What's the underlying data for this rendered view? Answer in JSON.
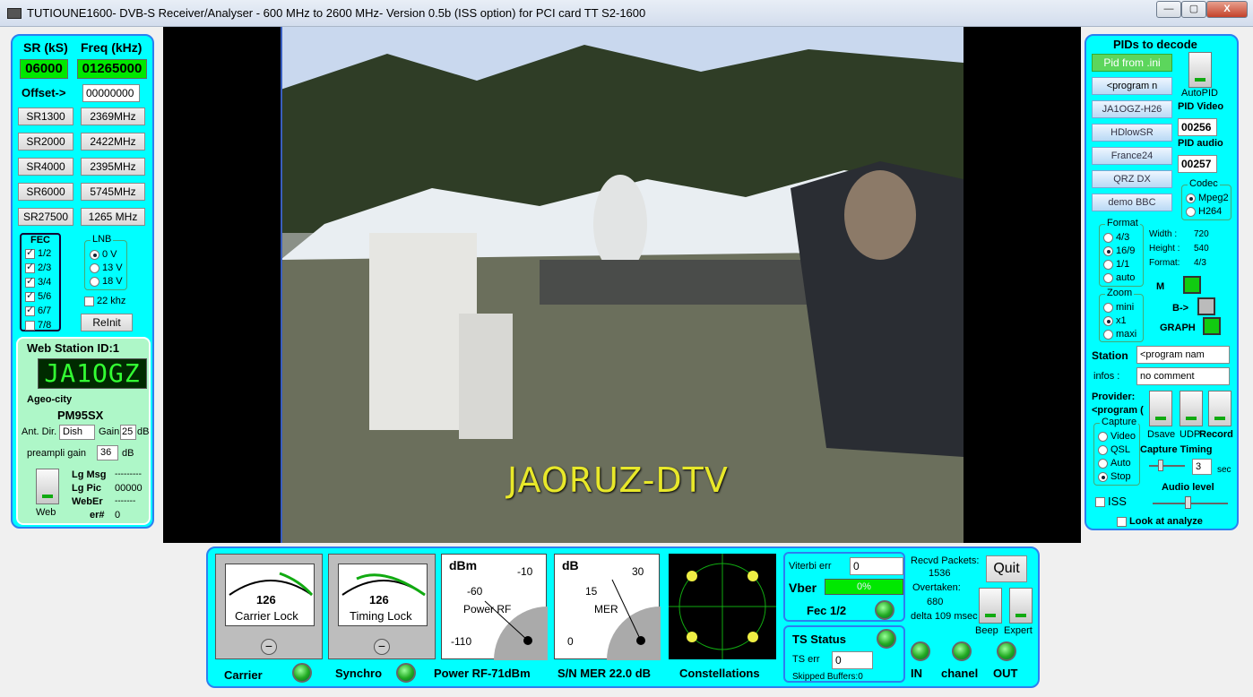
{
  "window": {
    "title": "TUTIOUNE1600- DVB-S Receiver/Analyser - 600 MHz to 2600 MHz- Version 0.5b (ISS option) for PCI card TT S2-1600",
    "min": "—",
    "max": "▢",
    "close": "X"
  },
  "left": {
    "sr_label": "SR (kS)",
    "freq_label": "Freq (kHz)",
    "sr_value": "06000",
    "freq_value": "01265000",
    "offset_label": "Offset->",
    "offset_value": "00000000",
    "sr_buttons": [
      "SR1300",
      "SR2000",
      "SR4000",
      "SR6000",
      "SR27500"
    ],
    "freq_buttons": [
      "2369MHz",
      "2422MHz",
      "2395MHz",
      "5745MHz",
      "1265 MHz"
    ],
    "fec_title": "FEC",
    "fec": [
      "1/2",
      "2/3",
      "3/4",
      "5/6",
      "6/7",
      "7/8"
    ],
    "lnb_title": "LNB",
    "lnb": [
      "0 V",
      "13 V",
      "18 V"
    ],
    "khz22": "22 khz",
    "reinit": "ReInit",
    "web_title": "Web Station ID:1",
    "callsign": "JA1OGZ",
    "city": "Ageo-city",
    "locator": "PM95SX",
    "ant_label": "Ant. Dir.",
    "ant_value": "Dish",
    "gain_label": "Gain",
    "gain_value": "25",
    "gain_unit": "dB",
    "preamp_label": "preampli gain",
    "preamp_value": "36",
    "preamp_unit": "dB",
    "web_label": "Web",
    "lgmsg_label": "Lg Msg",
    "lgmsg_value": "---------",
    "lgpic_label": "Lg Pic",
    "lgpic_value": "00000",
    "weber_label": "WebEr",
    "weber_value": "-------",
    "err_label": "er#",
    "err_value": "0"
  },
  "video": {
    "overlay": "JAORUZ-DTV"
  },
  "right": {
    "title": "PIDs to decode",
    "pid_ini": "Pid from .ini",
    "program_btn": "<program n",
    "preset_buttons": [
      "JA1OGZ-H26",
      "HDlowSR",
      "France24",
      "QRZ DX",
      "demo BBC"
    ],
    "autopid": "AutoPID",
    "pid_video_label": "PID Video",
    "pid_video": "00256",
    "pid_audio_label": "PID audio",
    "pid_audio": "00257",
    "codec_title": "Codec",
    "codec": [
      "Mpeg2",
      "H264"
    ],
    "format_title": "Format",
    "format": [
      "4/3",
      "16/9",
      "1/1",
      "auto"
    ],
    "width_label": "Width :",
    "width_value": "720",
    "height_label": "Height :",
    "height_value": "540",
    "fmt_label": "Format:",
    "fmt_value": "4/3",
    "zoom_title": "Zoom",
    "zoom": [
      "mini",
      "x1",
      "maxi"
    ],
    "m_label": "M",
    "b_label": "B->",
    "graph_label": "GRAPH",
    "station_label": "Station",
    "station_value": "<program nam",
    "infos_label": "infos :",
    "infos_value": "no comment",
    "provider_label": "Provider:",
    "provider_value": "<program (",
    "capture_title": "Capture",
    "capture": [
      "Video",
      "QSL",
      "Auto",
      "Stop"
    ],
    "dsave": "Dsave",
    "udp": "UDP",
    "record": "Record",
    "capture_timing": "Capture Timing",
    "timing_value": "3",
    "timing_unit": "sec",
    "audio_level": "Audio level",
    "iss": "ISS",
    "look": "Look at analyze"
  },
  "bottom": {
    "carrier_reading": "126",
    "carrier_lock": "Carrier Lock",
    "timing_reading": "126",
    "timing_lock": "Timing Lock",
    "rf_unit": "dBm",
    "rf_ticks": [
      "-10",
      "-60",
      "-110"
    ],
    "rf_name": "Power RF",
    "mer_unit": "dB",
    "mer_ticks": [
      "30",
      "15",
      "0"
    ],
    "mer_name": "MER",
    "carrier": "Carrier",
    "synchro": "Synchro",
    "power_rf": "Power RF-71dBm",
    "sn_mer": "S/N MER  22.0 dB",
    "constellations": "Constellations",
    "viterbi_label": "Viterbi err",
    "viterbi_value": "0",
    "vber_label": "Vber",
    "vber_value": "0%",
    "fec_label": "Fec  1/2",
    "ts_status": "TS Status",
    "ts_err_label": "TS err",
    "ts_err_value": "0",
    "skipped": "Skipped Buffers:0",
    "recvd_label": "Recvd Packets:",
    "recvd_value": "1536",
    "overtaken_label": "Overtaken:",
    "overtaken_value": "680",
    "delta": "delta 109 msec",
    "quit": "Quit",
    "beep": "Beep",
    "expert": "Expert",
    "in": "IN",
    "chanel": "chanel",
    "out": "OUT"
  },
  "colors": {
    "panel": "#00ffff",
    "border": "#2c7ff0",
    "green": "#00e800",
    "lcd": "#003300"
  }
}
